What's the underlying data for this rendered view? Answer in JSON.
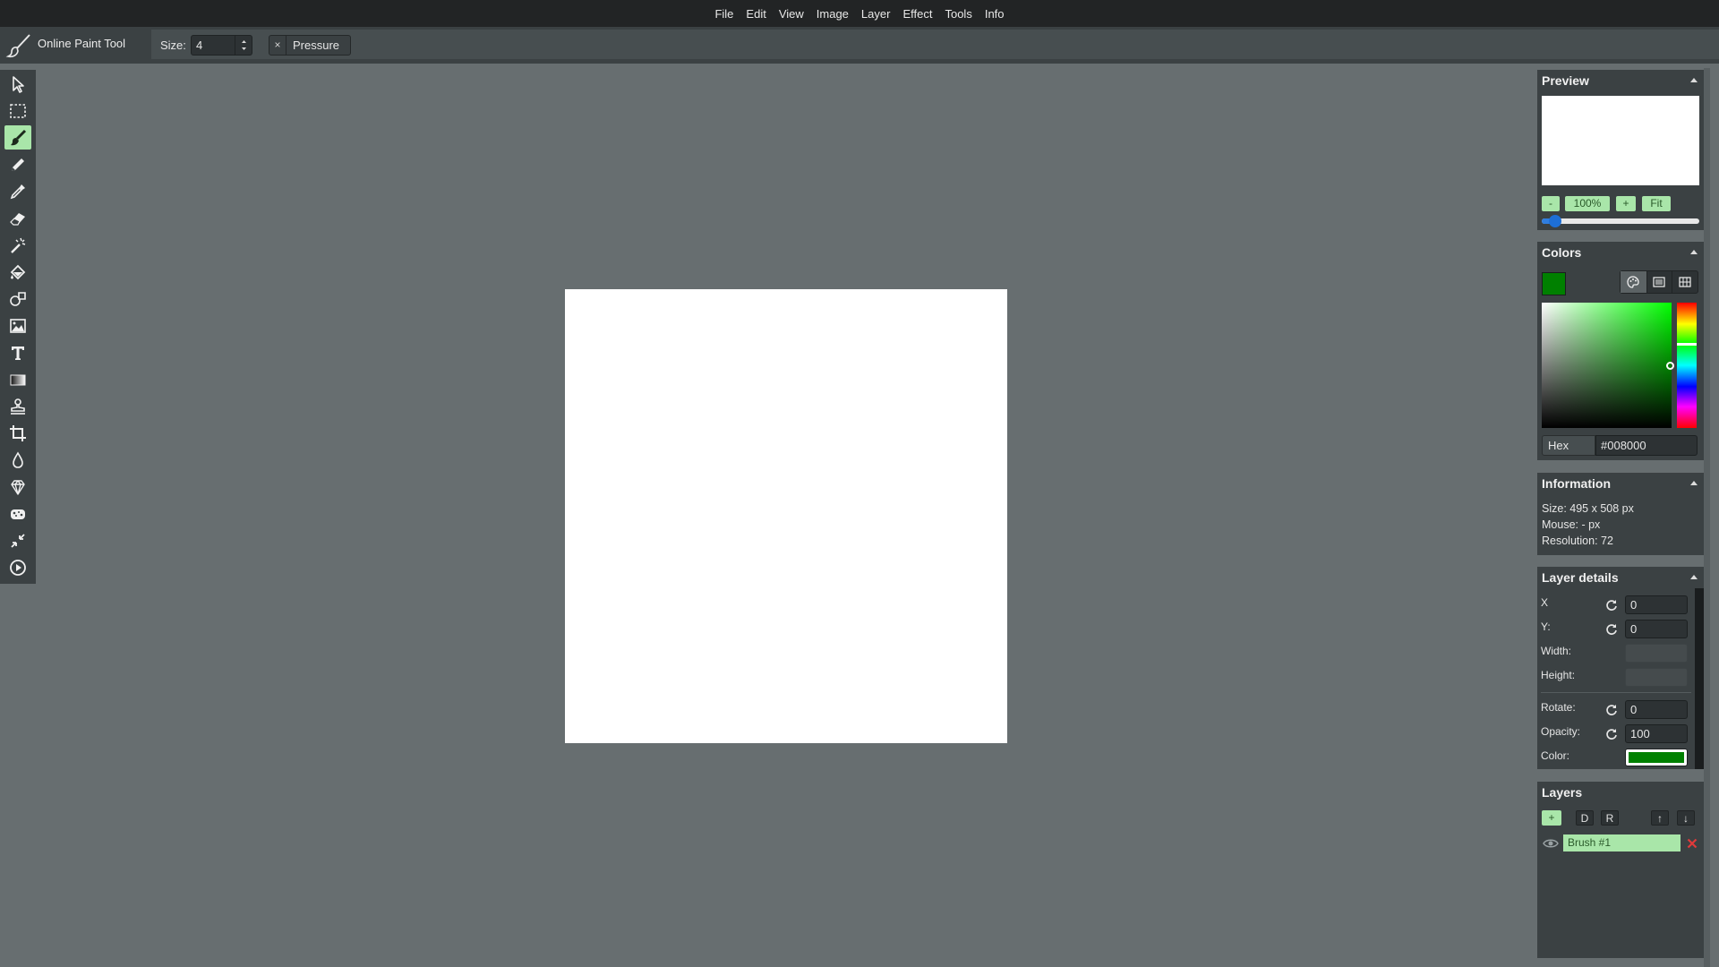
{
  "app": {
    "title": "Online Paint Tool"
  },
  "menu": [
    "File",
    "Edit",
    "View",
    "Image",
    "Layer",
    "Effect",
    "Tools",
    "Info"
  ],
  "tool_options": {
    "size_label": "Size:",
    "size_value": "4",
    "pressure_label": "Pressure",
    "pressure_close": "×"
  },
  "tools": [
    {
      "name": "select",
      "icon": "arrow-cursor-icon"
    },
    {
      "name": "selection",
      "icon": "dashed-rectangle-icon"
    },
    {
      "name": "brush",
      "icon": "brush-icon",
      "active": true
    },
    {
      "name": "pencil",
      "icon": "pencil-icon"
    },
    {
      "name": "color-picker",
      "icon": "eyedropper-icon"
    },
    {
      "name": "erase",
      "icon": "eraser-icon"
    },
    {
      "name": "magic-wand",
      "icon": "magic-wand-icon"
    },
    {
      "name": "fill",
      "icon": "paint-bucket-icon"
    },
    {
      "name": "shape",
      "icon": "shapes-icon"
    },
    {
      "name": "media",
      "icon": "image-icon"
    },
    {
      "name": "text",
      "icon": "text-icon"
    },
    {
      "name": "gradient",
      "icon": "gradient-icon"
    },
    {
      "name": "clone",
      "icon": "stamp-icon"
    },
    {
      "name": "crop",
      "icon": "crop-icon"
    },
    {
      "name": "blur",
      "icon": "drop-icon"
    },
    {
      "name": "sharpen",
      "icon": "diamond-icon"
    },
    {
      "name": "desaturate",
      "icon": "sponge-icon"
    },
    {
      "name": "bulge-pinch",
      "icon": "shrink-arrows-icon"
    },
    {
      "name": "animation",
      "icon": "play-icon"
    }
  ],
  "preview": {
    "title": "Preview",
    "zoom_out": "-",
    "zoom_value": "100%",
    "zoom_in": "+",
    "fit": "Fit",
    "zoom_slider": 0.05
  },
  "colors": {
    "title": "Colors",
    "current": "#008000",
    "hex_label": "Hex",
    "hex_value": "#008000"
  },
  "information": {
    "title": "Information",
    "size": "Size: 495 x 508 px",
    "mouse": "Mouse: - px",
    "resolution": "Resolution: 72"
  },
  "layer_details": {
    "title": "Layer details",
    "x_label": "X",
    "x_value": "0",
    "y_label": "Y:",
    "y_value": "0",
    "width_label": "Width:",
    "height_label": "Height:",
    "rotate_label": "Rotate:",
    "rotate_value": "0",
    "opacity_label": "Opacity:",
    "opacity_value": "100",
    "color_label": "Color:",
    "color_value": "#008000"
  },
  "layers": {
    "title": "Layers",
    "add": "+",
    "duplicate": "D",
    "raster": "R",
    "move_up": "↑",
    "move_down": "↓",
    "items": [
      {
        "name": "Brush #1",
        "visible": true
      }
    ]
  }
}
